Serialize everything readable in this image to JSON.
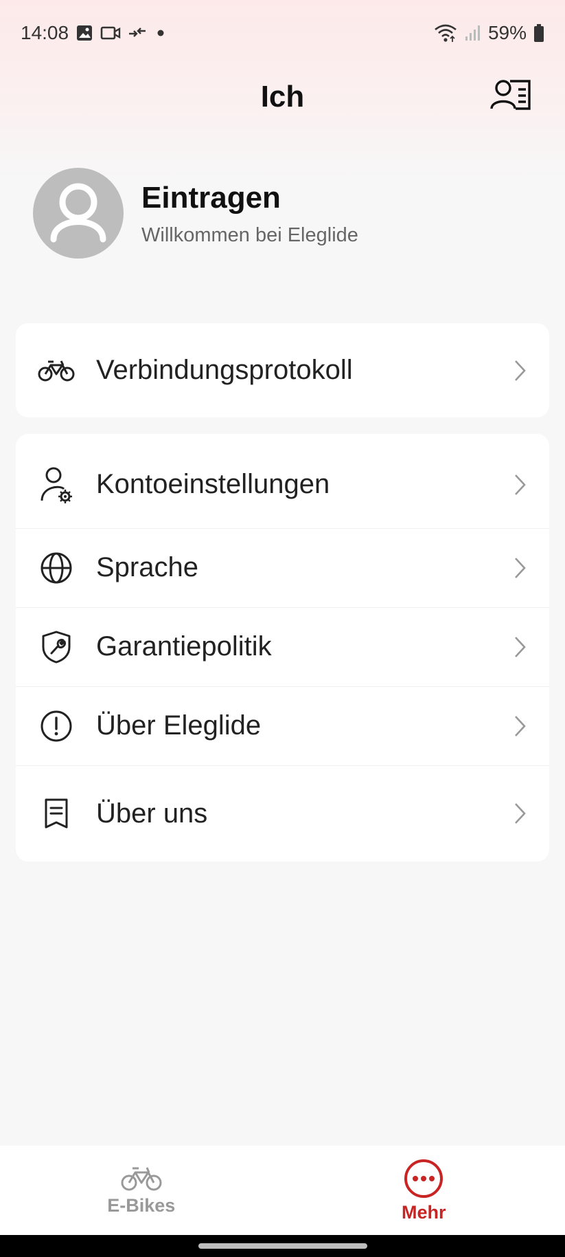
{
  "status_bar": {
    "time": "14:08",
    "battery": "59%"
  },
  "header": {
    "title": "Ich"
  },
  "profile": {
    "name": "Eintragen",
    "subtitle": "Willkommen bei Eleglide"
  },
  "menu_primary": [
    {
      "label": "Verbindungsprotokoll",
      "icon": "bike-icon"
    }
  ],
  "menu_secondary": [
    {
      "label": "Kontoeinstellungen",
      "icon": "user-settings-icon"
    },
    {
      "label": "Sprache",
      "icon": "globe-icon"
    },
    {
      "label": "Garantiepolitik",
      "icon": "shield-wrench-icon"
    },
    {
      "label": "Über Eleglide",
      "icon": "info-exclamation-icon"
    },
    {
      "label": "Über uns",
      "icon": "document-icon"
    }
  ],
  "tabbar": {
    "tabs": [
      {
        "label": "E-Bikes",
        "icon": "bike-icon",
        "active": false
      },
      {
        "label": "Mehr",
        "icon": "more-dots-icon",
        "active": true
      }
    ]
  },
  "colors": {
    "accent": "#c92424",
    "inactive": "#999999",
    "avatar_bg": "#bdbdbd"
  }
}
